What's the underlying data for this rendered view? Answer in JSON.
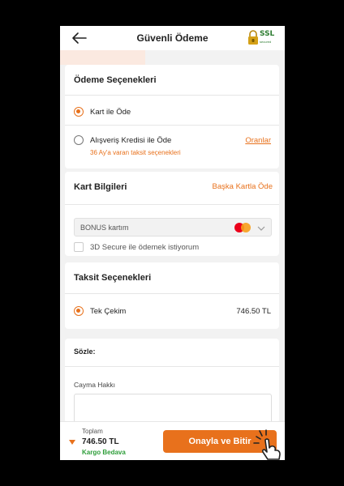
{
  "header": {
    "title": "Güvenli Ödeme",
    "ssl_label": "SSL",
    "ssl_sub": "secured"
  },
  "payment_options": {
    "title": "Ödeme Seçenekleri",
    "option_card": "Kart ile Öde",
    "option_credit": "Alışveriş Kredisi ile Öde",
    "credit_rates_link": "Oranlar",
    "credit_subtitle": "36 Ay'a varan taksit seçenekleri"
  },
  "card_info": {
    "title": "Kart Bilgileri",
    "other_card_link": "Başka Kartla Öde",
    "selected_card": "BONUS kartım",
    "secure_checkbox_label": "3D Secure ile ödemek istiyorum"
  },
  "installments": {
    "title": "Taksit Seçenekleri",
    "option_label": "Tek Çekim",
    "option_amount": "746.50 TL"
  },
  "contracts": {
    "title": "Sözle:",
    "cancellation_label": "Cayma Hakkı"
  },
  "footer": {
    "total_label": "Toplam",
    "total_amount": "746.50 TL",
    "shipping": "Kargo Bedava",
    "confirm_button": "Onayla ve Bitir"
  },
  "colors": {
    "accent": "#e8711c",
    "shipping_green": "#2e9e3a"
  }
}
